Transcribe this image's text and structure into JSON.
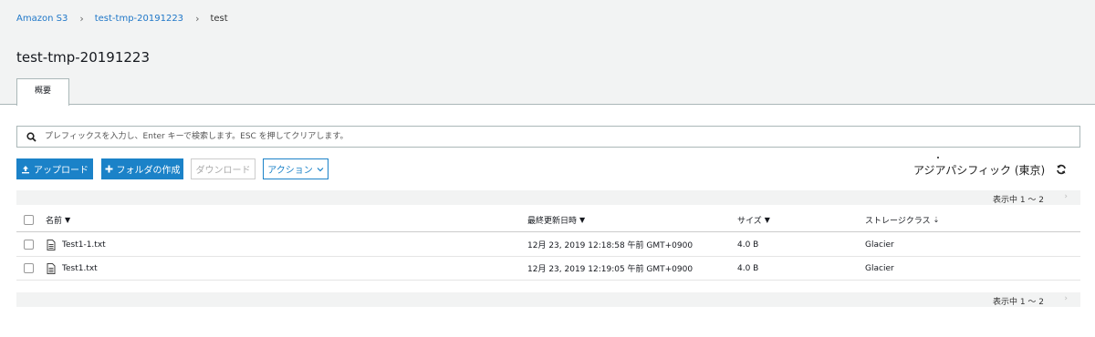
{
  "breadcrumb": {
    "root": "Amazon S3",
    "bucket": "test-tmp-20191223",
    "current": "test"
  },
  "page": {
    "title": "test-tmp-20191223",
    "tab_overview": "概要"
  },
  "search": {
    "placeholder": "プレフィックスを入力し、Enter キーで検索します。ESC を押してクリアします。"
  },
  "toolbar": {
    "upload": "アップロード",
    "create_folder": "フォルダの作成",
    "download": "ダウンロード",
    "actions": "アクション"
  },
  "region": "アジアパシフィック (東京)",
  "pager": {
    "label": "表示中 1 ～ 2"
  },
  "table": {
    "columns": {
      "name": "名前",
      "last_modified": "最終更新日時",
      "size": "サイズ",
      "storage_class": "ストレージクラス"
    },
    "rows": [
      {
        "name": "Test1-1.txt",
        "last_modified": "12月 23, 2019 12:18:58 午前 GMT+0900",
        "size": "4.0 B",
        "storage_class": "Glacier"
      },
      {
        "name": "Test1.txt",
        "last_modified": "12月 23, 2019 12:19:05 午前 GMT+0900",
        "size": "4.0 B",
        "storage_class": "Glacier"
      }
    ]
  },
  "colors": {
    "accent": "#1b82c8",
    "header_bg": "#f2f3f3"
  }
}
